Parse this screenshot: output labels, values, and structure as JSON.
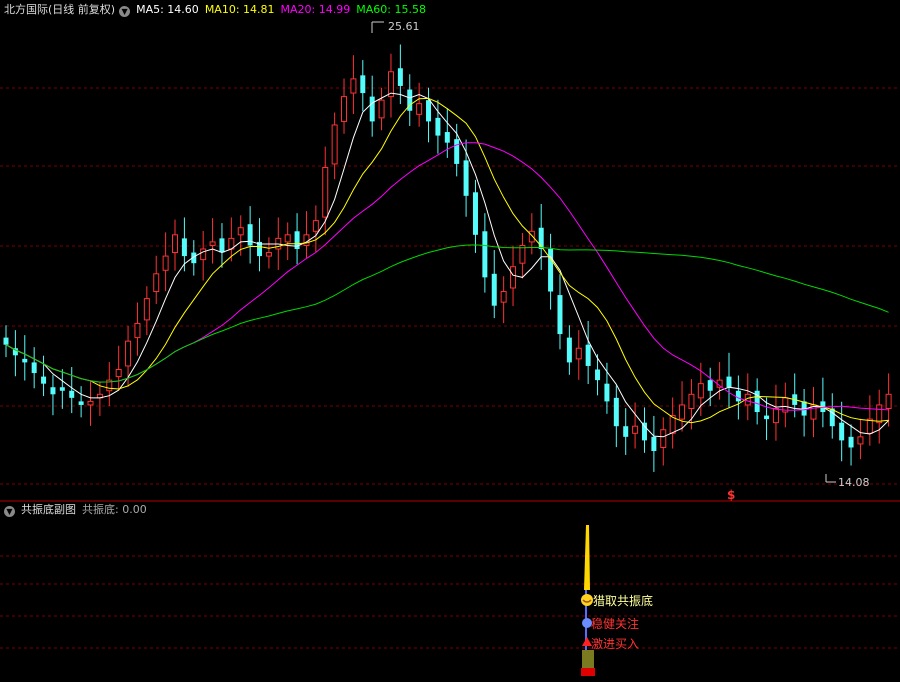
{
  "main_header": {
    "title": "北方国际(日线 前复权)",
    "ma_labels": [
      {
        "text": "MA5: 14.60",
        "color": "#ffffff"
      },
      {
        "text": "MA10: 14.81",
        "color": "#ffff00"
      },
      {
        "text": "MA20: 14.99",
        "color": "#ff00ff"
      },
      {
        "text": "MA60: 15.58",
        "color": "#00ff00"
      }
    ]
  },
  "sub_header": {
    "title": "共振底副图",
    "value_label": "共振底: 0.00"
  },
  "price_labels": {
    "high": "25.61",
    "low": "14.08"
  },
  "event_marker": "$",
  "signals": [
    {
      "text": "猎取共振底",
      "color": "#ffff99"
    },
    {
      "text": "稳健关注",
      "color": "#ff3333"
    },
    {
      "text": "激进买入",
      "color": "#ff3333"
    }
  ],
  "colors": {
    "up": "#ff3232",
    "down": "#54fcfc",
    "grid": "#7a0000",
    "ma5": "#ffffff",
    "ma10": "#ffff00",
    "ma20": "#ff00ff",
    "ma60": "#00d800"
  },
  "chart_data": {
    "type": "candlestick",
    "price_range": [
      13.2,
      26.8
    ],
    "highest": 25.61,
    "lowest": 14.08,
    "ma_current": {
      "ma5": 14.6,
      "ma10": 14.81,
      "ma20": 14.99,
      "ma60": 15.58
    },
    "close": [
      17.3,
      17.0,
      16.8,
      16.5,
      16.2,
      15.9,
      16.0,
      15.8,
      15.6,
      15.7,
      15.9,
      16.3,
      16.6,
      17.4,
      17.9,
      18.6,
      19.3,
      19.8,
      20.4,
      19.8,
      19.6,
      20.0,
      20.2,
      19.9,
      20.3,
      20.6,
      20.1,
      19.8,
      19.9,
      20.3,
      20.4,
      20.0,
      20.4,
      20.8,
      22.3,
      23.5,
      24.3,
      24.8,
      24.4,
      23.6,
      24.2,
      25.0,
      24.6,
      23.9,
      24.1,
      23.6,
      23.2,
      23.0,
      22.4,
      21.5,
      20.4,
      19.2,
      18.4,
      18.8,
      19.5,
      20.1,
      20.5,
      20.0,
      18.8,
      17.6,
      16.8,
      17.2,
      16.7,
      16.3,
      15.7,
      15.0,
      14.7,
      15.0,
      14.6,
      14.3,
      14.9,
      15.3,
      15.6,
      15.9,
      16.2,
      16.0,
      16.3,
      16.1,
      15.7,
      15.9,
      15.4,
      15.2,
      15.5,
      15.8,
      15.6,
      15.3,
      15.6,
      15.4,
      15.0,
      14.6,
      14.4,
      14.7,
      15.2,
      15.6,
      15.9
    ],
    "open": [
      17.5,
      17.2,
      16.9,
      16.8,
      16.4,
      16.1,
      16.1,
      16.0,
      15.7,
      15.6,
      15.8,
      16.0,
      16.4,
      16.7,
      17.5,
      18.0,
      18.8,
      19.4,
      19.9,
      20.3,
      19.9,
      19.7,
      20.1,
      20.3,
      20.0,
      20.4,
      20.7,
      20.2,
      19.8,
      20.0,
      20.2,
      20.5,
      20.1,
      20.5,
      20.9,
      22.4,
      23.6,
      24.4,
      24.9,
      24.3,
      23.7,
      24.3,
      25.1,
      24.5,
      23.8,
      24.2,
      23.7,
      23.3,
      23.1,
      22.5,
      21.6,
      20.5,
      19.3,
      18.5,
      18.9,
      19.6,
      20.2,
      20.6,
      20.0,
      18.7,
      17.5,
      16.9,
      17.3,
      16.6,
      16.2,
      15.8,
      15.0,
      14.8,
      15.1,
      14.7,
      14.4,
      14.8,
      15.2,
      15.5,
      15.8,
      16.3,
      16.1,
      16.4,
      16.0,
      15.6,
      16.0,
      15.3,
      15.1,
      15.4,
      15.9,
      15.7,
      15.2,
      15.7,
      15.5,
      15.1,
      14.7,
      14.5,
      14.8,
      15.1,
      15.5
    ]
  }
}
